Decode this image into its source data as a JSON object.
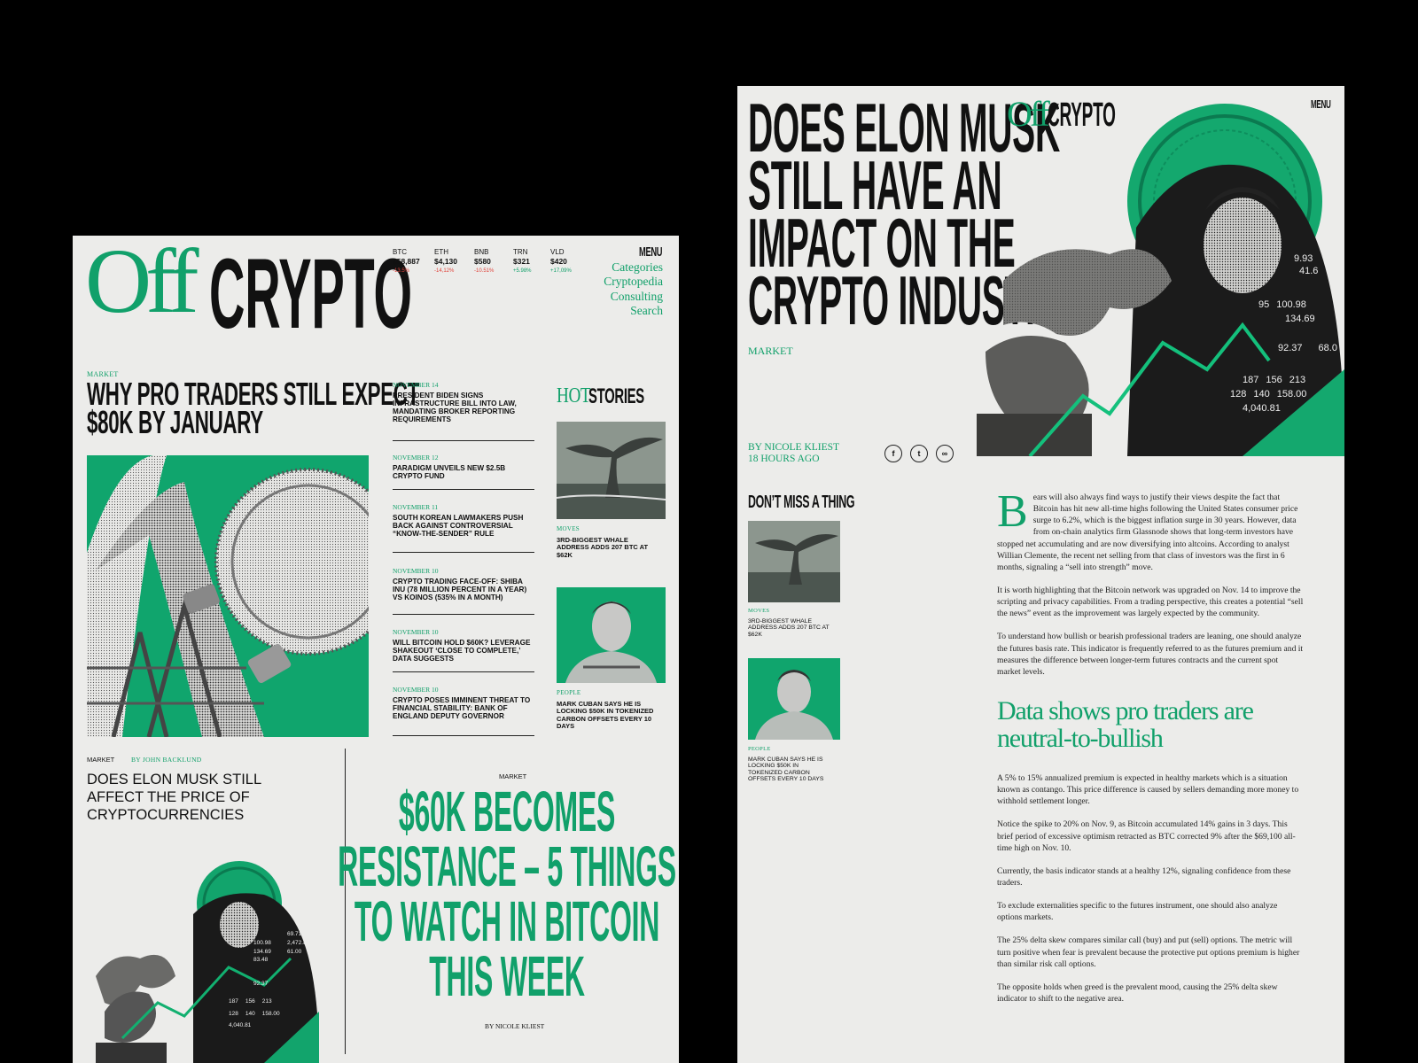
{
  "brand": {
    "off": "Off",
    "crypto": "CRYPTO"
  },
  "ticker": [
    {
      "symbol": "BTC",
      "price": "$58,887",
      "change": "-13.5%",
      "dir": "neg"
    },
    {
      "symbol": "ETH",
      "price": "$4,130",
      "change": "-14,12%",
      "dir": "neg"
    },
    {
      "symbol": "BNB",
      "price": "$580",
      "change": "-10.51%",
      "dir": "neg"
    },
    {
      "symbol": "TRN",
      "price": "$321",
      "change": "+5.98%",
      "dir": "pos"
    },
    {
      "symbol": "VLD",
      "price": "$420",
      "change": "+17,09%",
      "dir": "pos"
    }
  ],
  "nav": {
    "menu": "MENU",
    "items": [
      "Categories",
      "Cryptopedia",
      "Consulting",
      "Search"
    ]
  },
  "lead": {
    "tag": "MARKET",
    "title_line1": "WHY PRO TRADERS STILL EXPECT",
    "title_line2": "$80K BY JANUARY"
  },
  "news": [
    {
      "date": "NOVEMBER 14",
      "title": "PRESIDENT BIDEN SIGNS INFRASTRUCTURE BILL INTO LAW, MANDATING BROKER REPORTING REQUIREMENTS"
    },
    {
      "date": "NOVEMBER 12",
      "title": "PARADIGM UNVEILS NEW $2.5B CRYPTO FUND"
    },
    {
      "date": "NOVEMBER 11",
      "title": "SOUTH KOREAN LAWMAKERS PUSH BACK AGAINST CONTROVERSIAL “KNOW-THE-SENDER” RULE"
    },
    {
      "date": "NOVEMBER 10",
      "title": "CRYPTO TRADING FACE-OFF: SHIBA INU (78 MILLION PERCENT IN A YEAR) VS KOINOS (535% IN A MONTH)"
    },
    {
      "date": "NOVEMBER 10",
      "title": "WILL BITCOIN HOLD $60K? LEVERAGE SHAKEOUT ‘CLOSE TO COMPLETE,’ DATA SUGGESTS"
    },
    {
      "date": "NOVEMBER 10",
      "title": "CRYPTO POSES IMMINENT THREAT TO FINANCIAL STABILITY: BANK OF ENGLAND DEPUTY GOVERNOR"
    }
  ],
  "hot": {
    "hot": "HOT",
    "stories": "STORIES",
    "items": [
      {
        "tag": "MOVES",
        "title": "3RD-BIGGEST WHALE ADDRESS ADDS 207 BTC AT $62K"
      },
      {
        "tag": "PEOPLE",
        "title": "MARK CUBAN SAYS HE IS LOCKING $50K IN TOKENIZED CARBON OFFSETS EVERY 10 DAYS"
      }
    ]
  },
  "musk_card": {
    "tag": "MARKET",
    "byline": "BY JOHN BACKLUND",
    "title": "DOES ELON MUSK STILL AFFECT THE PRICE OF CRYPTOCURRENCIES",
    "numbers": [
      "5",
      "100.98",
      "134.69",
      "83.48",
      "92.37",
      "187",
      "156",
      "213",
      "128",
      "140",
      "158.00",
      "4,040.81",
      "69.71",
      "2,472.87",
      "61.00"
    ]
  },
  "feature": {
    "tag": "MARKET",
    "lines": [
      "$60K BECOMES",
      "RESISTANCE – 5 THINGS",
      "TO WATCH IN BITCOIN",
      "THIS WEEK"
    ],
    "byline": "BY NICOLE KLIEST"
  },
  "article": {
    "title_lines": [
      "DOES ELON MUSK",
      "STILL HAVE AN",
      "IMPACT ON THE",
      "CRYPTO INDUSTRY?"
    ],
    "tag": "MARKET",
    "author": "BY NICOLE KLIEST",
    "time": "18 HOURS AGO",
    "menu": "MENU",
    "share": [
      {
        "icon": "facebook-icon",
        "glyph": "f"
      },
      {
        "icon": "twitter-icon",
        "glyph": "t"
      },
      {
        "icon": "link-icon",
        "glyph": "∞"
      }
    ],
    "hero_numbers": [
      "9.93",
      "41.6",
      "95",
      "100.98",
      "134.69",
      "92.37",
      "68.0",
      "187",
      "156",
      "213",
      "128",
      "140",
      "158.00",
      "4,040.81"
    ],
    "dropcap": "B",
    "paragraphs": [
      "ears will also always find ways to justify their views despite the fact that Bitcoin has hit new all-time highs following the United States consumer price surge to 6.2%, which is the biggest inflation surge in 30 years. However, data from on-chain analytics firm Glassnode shows that long-term investors have stopped net accumulating and are now diversifying into altcoins. According to analyst Willian Clemente, the recent net selling from that class of investors was the first in 6 months, signaling a “sell into strength” move.",
      "It is worth highlighting that the Bitcoin network was upgraded on Nov. 14 to improve the scripting and privacy capabilities. From a trading perspective, this creates a potential “sell the news” event as the improvement was largely expected by the community.",
      "To understand how bullish or bearish professional traders are leaning, one should analyze the futures basis rate. This indicator is frequently referred to as the futures premium and it measures the difference between longer-term futures contracts and the current spot market levels."
    ],
    "subhead_line1": "Data shows pro traders are",
    "subhead_line2": "neutral-to-bullish",
    "paragraphs2": [
      "A 5% to 15% annualized premium is expected in healthy markets which is a situation known as contango. This price difference is caused by sellers demanding more money to withhold settlement longer.",
      "Notice the spike to 20% on Nov. 9, as Bitcoin accumulated 14% gains in 3 days. This brief period of excessive optimism retracted as BTC corrected 9% after the $69,100 all-time high on Nov. 10.",
      "Currently, the basis indicator stands at a healthy 12%, signaling confidence from these traders.",
      "To exclude externalities specific to the futures instrument, one should also analyze options markets.",
      "The 25% delta skew compares similar call (buy) and put (sell) options. The metric will turn positive when fear is prevalent because the protective put options premium is higher than similar risk call options.",
      "The opposite holds when greed is the prevalent mood, causing the 25% delta skew indicator to shift to the negative area."
    ]
  },
  "dont_miss": {
    "title": "DON’T MISS A THING",
    "items": [
      {
        "tag": "MOVES",
        "title": "3RD-BIGGEST WHALE ADDRESS ADDS 207 BTC AT $62K"
      },
      {
        "tag": "PEOPLE",
        "title": "MARK CUBAN SAYS HE IS LOCKING $50K IN TOKENIZED CARBON OFFSETS EVERY 10 DAYS"
      }
    ]
  },
  "colors": {
    "accent": "#11a06a",
    "paper": "#ececea",
    "ink": "#111111",
    "negative": "#e0443c"
  }
}
